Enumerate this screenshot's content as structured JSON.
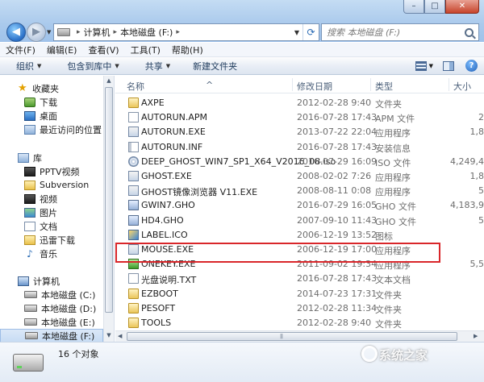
{
  "window": {
    "buttons": {
      "minimize": "–",
      "maximize": "□",
      "close": "✕"
    }
  },
  "navigation": {
    "back_glyph": "◀",
    "forward_glyph": "▶",
    "dropdown_glyph": "▼"
  },
  "address": {
    "crumbs": [
      "计算机",
      "本地磁盘 (F:)"
    ],
    "separator": "▸",
    "dropdown_glyph": "▼",
    "refresh_glyph": "⟳"
  },
  "search": {
    "placeholder": "搜索 本地磁盘 (F:)"
  },
  "menubar": {
    "items": [
      "文件(F)",
      "编辑(E)",
      "查看(V)",
      "工具(T)",
      "帮助(H)"
    ]
  },
  "commandbar": {
    "organize": "组织",
    "include_in_library": "包含到库中",
    "share": "共享",
    "new_folder": "新建文件夹",
    "help": "?"
  },
  "navpane": {
    "favorites": {
      "title": "收藏夹",
      "items": [
        "下载",
        "桌面",
        "最近访问的位置"
      ]
    },
    "libraries": {
      "title": "库",
      "items": [
        "PPTV视频",
        "Subversion",
        "视频",
        "图片",
        "文档",
        "迅雷下载",
        "音乐"
      ]
    },
    "computer": {
      "title": "计算机",
      "items": [
        "本地磁盘 (C:)",
        "本地磁盘 (D:)",
        "本地磁盘 (E:)",
        "本地磁盘 (F:)"
      ],
      "selected_index": 3
    }
  },
  "filelist": {
    "columns": {
      "name": "名称",
      "date": "修改日期",
      "type": "类型",
      "size": "大小"
    },
    "sort_glyph": "^",
    "rows": [
      {
        "name": "AXPE",
        "date": "2012-02-28 9:40",
        "type": "文件夹",
        "size": "",
        "icon": "folder-icon"
      },
      {
        "name": "AUTORUN.APM",
        "date": "2016-07-28 17:43",
        "type": "APM 文件",
        "size": "2",
        "icon": "document-icon"
      },
      {
        "name": "AUTORUN.EXE",
        "date": "2013-07-22 22:04",
        "type": "应用程序",
        "size": "1,8",
        "icon": "exe-icon"
      },
      {
        "name": "AUTORUN.INF",
        "date": "2016-07-28 17:43",
        "type": "安装信息",
        "size": "",
        "icon": "inf-icon"
      },
      {
        "name": "DEEP_GHOST_WIN7_SP1_X64_V2016_08.iso",
        "date": "2016-07-29 16:09",
        "type": "ISO 文件",
        "size": "4,249,4",
        "icon": "iso-icon"
      },
      {
        "name": "GHOST.EXE",
        "date": "2008-02-02 7:26",
        "type": "应用程序",
        "size": "1,8",
        "icon": "exe-icon"
      },
      {
        "name": "GHOST镜像浏览器 V11.EXE",
        "date": "2008-08-11 0:08",
        "type": "应用程序",
        "size": "5",
        "icon": "exe-icon"
      },
      {
        "name": "GWIN7.GHO",
        "date": "2016-07-29 16:05",
        "type": "GHO 文件",
        "size": "4,183,9",
        "icon": "gho-icon"
      },
      {
        "name": "HD4.GHO",
        "date": "2007-09-10 11:43",
        "type": "GHO 文件",
        "size": "5",
        "icon": "gho-icon"
      },
      {
        "name": "LABEL.ICO",
        "date": "2006-12-19 13:52",
        "type": "图标",
        "size": "",
        "icon": "ico-icon"
      },
      {
        "name": "MOUSE.EXE",
        "date": "2006-12-19 17:00",
        "type": "应用程序",
        "size": "",
        "icon": "exe-icon"
      },
      {
        "name": "ONEKEY.EXE",
        "date": "2011-09-02 19:34",
        "type": "应用程序",
        "size": "5,5",
        "icon": "green-exe-icon"
      },
      {
        "name": "光盘说明.TXT",
        "date": "2016-07-28 17:43",
        "type": "文本文档",
        "size": "",
        "icon": "document-icon"
      },
      {
        "name": "EZBOOT",
        "date": "2014-07-23 17:31",
        "type": "文件夹",
        "size": "",
        "icon": "folder-icon"
      },
      {
        "name": "PESOFT",
        "date": "2012-02-28 11:34",
        "type": "文件夹",
        "size": "",
        "icon": "folder-icon"
      },
      {
        "name": "TOOLS",
        "date": "2012-02-28 9:40",
        "type": "文件夹",
        "size": "",
        "icon": "folder-icon"
      }
    ]
  },
  "scroll_glyphs": {
    "up": "▲",
    "down": "▼",
    "left": "◀",
    "right": "▶",
    "grip": "|||"
  },
  "details": {
    "count_text": "16 个对象"
  },
  "watermark": {
    "text": "系统之家"
  },
  "colors": {
    "highlight": "#d9262a",
    "accent": "#2a70c8"
  }
}
